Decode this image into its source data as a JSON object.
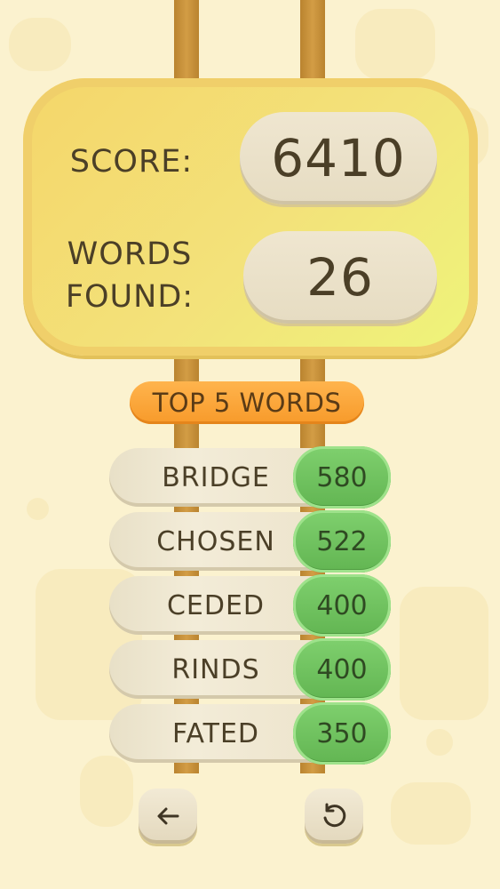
{
  "score": {
    "label": "SCORE:",
    "value": "6410"
  },
  "words_found": {
    "label_line1": "WORDS",
    "label_line2": "FOUND:",
    "value": "26"
  },
  "top_words": {
    "title": "TOP 5 WORDS",
    "items": [
      {
        "word": "BRIDGE",
        "points": "580"
      },
      {
        "word": "CHOSEN",
        "points": "522"
      },
      {
        "word": "CEDED",
        "points": "400"
      },
      {
        "word": "RINDS",
        "points": "400"
      },
      {
        "word": "FATED",
        "points": "350"
      }
    ]
  },
  "icons": {
    "back": "arrow-left-icon",
    "replay": "replay-icon"
  },
  "colors": {
    "background": "#fbf2cf",
    "panel": "#f3e27a",
    "accent": "#f79a2a",
    "points": "#6cc15c"
  }
}
